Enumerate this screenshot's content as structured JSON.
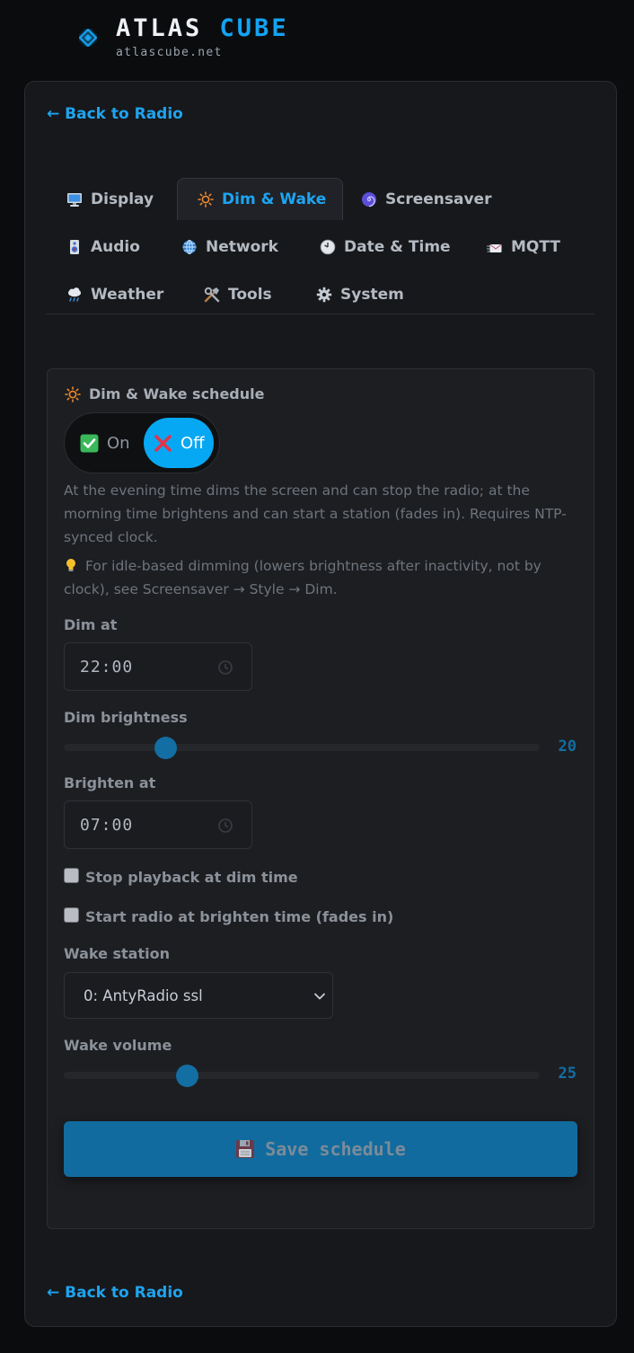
{
  "brand": {
    "title_main": "ATLAS",
    "title_accent": "CUBE",
    "subtitle": "atlascube.net",
    "accent_color": "#14a3f2"
  },
  "nav": {
    "back_label": "← Back to Radio"
  },
  "tabs": [
    {
      "label": "Display",
      "icon": "monitor-icon",
      "active": false
    },
    {
      "label": "Dim & Wake",
      "icon": "sun-icon",
      "active": true
    },
    {
      "label": "Screensaver",
      "icon": "swirl-icon",
      "active": false
    },
    {
      "label": "Audio",
      "icon": "speaker-icon",
      "active": false
    },
    {
      "label": "Network",
      "icon": "globe-icon",
      "active": false
    },
    {
      "label": "Date & Time",
      "icon": "clock-icon",
      "active": false
    },
    {
      "label": "MQTT",
      "icon": "message-icon",
      "active": false
    },
    {
      "label": "Weather",
      "icon": "cloud-rain-icon",
      "active": false
    },
    {
      "label": "Tools",
      "icon": "tools-icon",
      "active": false
    },
    {
      "label": "System",
      "icon": "gear-icon",
      "active": false
    }
  ],
  "schedule": {
    "title": "Dim & Wake schedule",
    "toggle": {
      "on_label": "On",
      "off_label": "Off",
      "selected": "Off"
    },
    "description": "At the evening time dims the screen and can stop the radio; at the morning time brightens and can start a station (fades in). Requires NTP-synced clock.",
    "tip": "For idle-based dimming (lowers brightness after inactivity, not by clock), see Screensaver → Style → Dim.",
    "dim_at_label": "Dim at",
    "dim_at_value": "22:00",
    "dim_brightness_label": "Dim brightness",
    "dim_brightness_value": "20",
    "dim_brightness_fraction": 0.213,
    "brighten_at_label": "Brighten at",
    "brighten_at_value": "07:00",
    "stop_playback_label": "Stop playback at dim time",
    "stop_playback_checked": false,
    "start_radio_label": "Start radio at brighten time (fades in)",
    "start_radio_checked": false,
    "wake_station_label": "Wake station",
    "wake_station_value": "0: AntyRadio ssl",
    "wake_volume_label": "Wake volume",
    "wake_volume_value": "25",
    "wake_volume_fraction": 0.259,
    "save_label": "Save schedule"
  }
}
